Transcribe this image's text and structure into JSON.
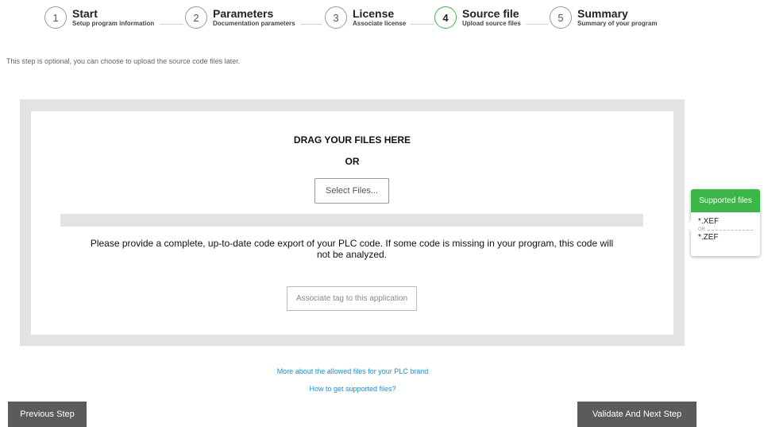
{
  "stepper": {
    "steps": [
      {
        "number": "1",
        "title": "Start",
        "subtitle": "Setup program information"
      },
      {
        "number": "2",
        "title": "Parameters",
        "subtitle": "Documentation parameters"
      },
      {
        "number": "3",
        "title": "License",
        "subtitle": "Associate license"
      },
      {
        "number": "4",
        "title": "Source file",
        "subtitle": "Upload source files"
      },
      {
        "number": "5",
        "title": "Summary",
        "subtitle": "Summary of your program"
      }
    ],
    "active_step": 4
  },
  "intro_text": "This step is optional, you can choose to upload the source code files later.",
  "upload": {
    "drag_title": "DRAG YOUR FILES HERE",
    "or_label": "OR",
    "select_button": "Select Files...",
    "progress": 0,
    "note": "Please provide a complete, up-to-date code export of your PLC code. If some code is missing in your program, this code will not be analyzed.",
    "tag_button": "Associate tag to this application"
  },
  "supported_files": {
    "header": "Supported files",
    "extensions": [
      "*.XEF",
      "*.ZEF"
    ],
    "separator": "OR"
  },
  "links": {
    "allowed_files": "More about the allowed files for your PLC brand",
    "how_to": "How to get supported files?"
  },
  "buttons": {
    "previous": "Previous Step",
    "next": "Validate And Next Step"
  },
  "colors": {
    "accent": "#3cb648",
    "dark_button": "#5b5b5b",
    "link": "#1a8fd0"
  }
}
